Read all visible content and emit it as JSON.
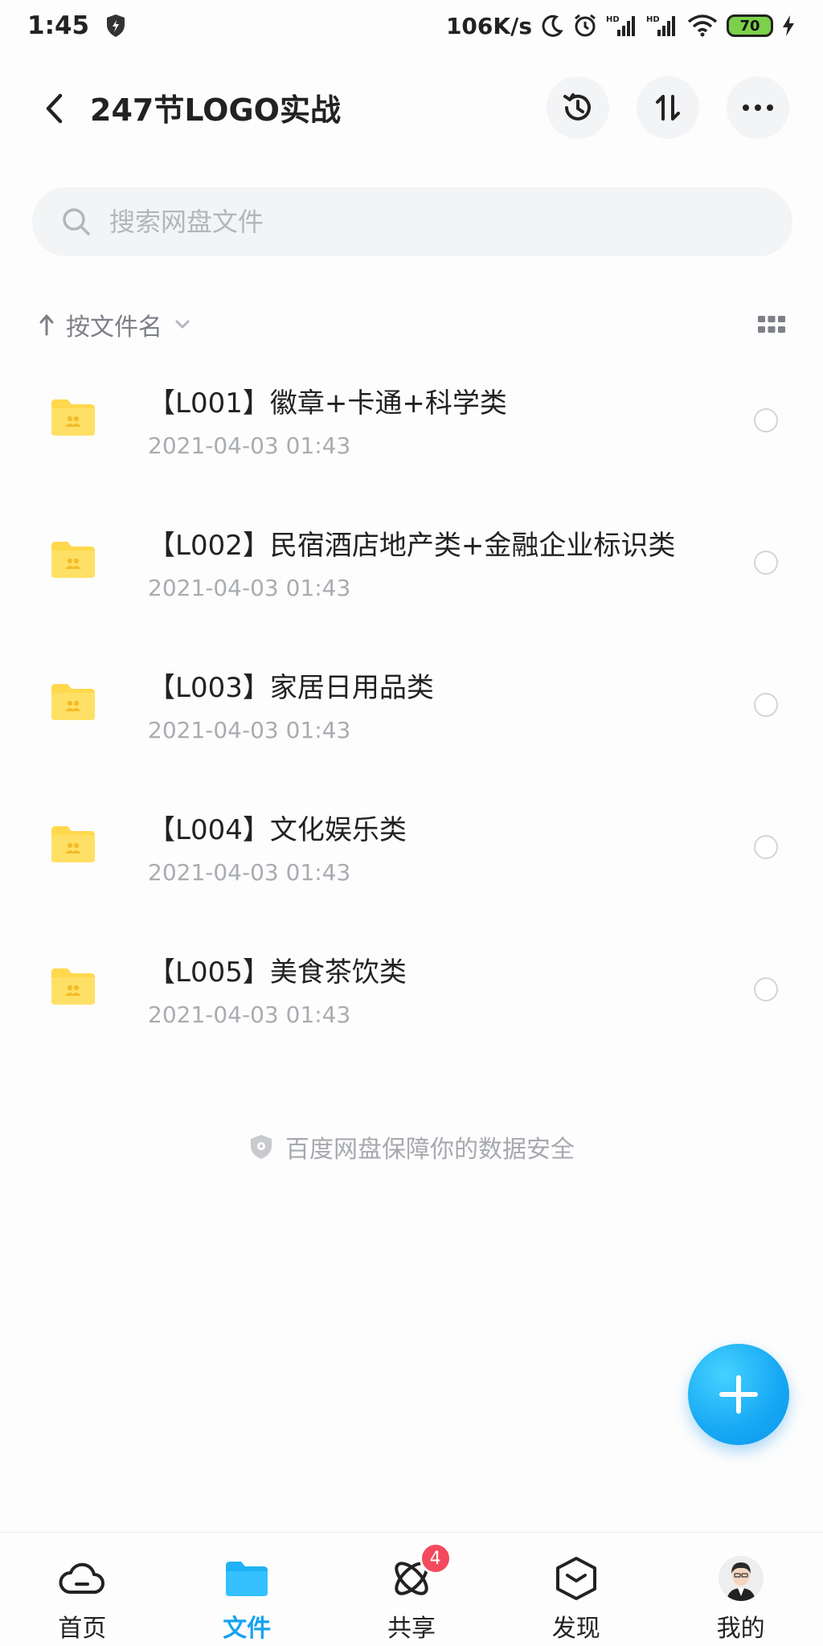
{
  "status_bar": {
    "time": "1:45",
    "net_speed": "106K/s",
    "battery": "70"
  },
  "header": {
    "title": "247节LOGO实战"
  },
  "search": {
    "placeholder": "搜索网盘文件"
  },
  "sort": {
    "label": "按文件名"
  },
  "files": [
    {
      "name": "【L001】徽章+卡通+科学类",
      "date": "2021-04-03  01:43"
    },
    {
      "name": "【L002】民宿酒店地产类+金融企业标识类",
      "date": "2021-04-03  01:43"
    },
    {
      "name": "【L003】家居日用品类",
      "date": "2021-04-03  01:43"
    },
    {
      "name": "【L004】文化娱乐类",
      "date": "2021-04-03  01:43"
    },
    {
      "name": "【L005】美食茶饮类",
      "date": "2021-04-03  01:43"
    }
  ],
  "safety_notice": "百度网盘保障你的数据安全",
  "nav": {
    "items": [
      {
        "label": "首页",
        "icon": "cloud-icon"
      },
      {
        "label": "文件",
        "icon": "folder-icon"
      },
      {
        "label": "共享",
        "icon": "share-orbit-icon",
        "badge": "4"
      },
      {
        "label": "发现",
        "icon": "discover-box-icon"
      },
      {
        "label": "我的",
        "icon": "avatar"
      }
    ],
    "active": "文件"
  },
  "colors": {
    "accent": "#17a3ef",
    "folder": "#ffd84d",
    "badge": "#f24a5c"
  }
}
